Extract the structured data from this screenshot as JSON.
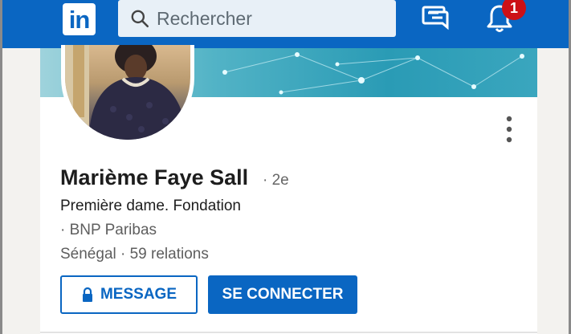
{
  "header": {
    "logo_text": "in",
    "search_placeholder": "Rechercher",
    "notification_count": "1",
    "brand_color": "#0a66c2",
    "icons": [
      "linkedin-logo",
      "search-icon",
      "messaging-icon",
      "bell-icon"
    ]
  },
  "profile": {
    "name": "Marième Faye Sall",
    "degree": "· 2e",
    "headline": "Première dame. Fondation",
    "company": "· BNP Paribas",
    "location": "Sénégal · 59 relations"
  },
  "actions": {
    "message_label": "MESSAGE",
    "connect_label": "SE CONNECTER"
  }
}
